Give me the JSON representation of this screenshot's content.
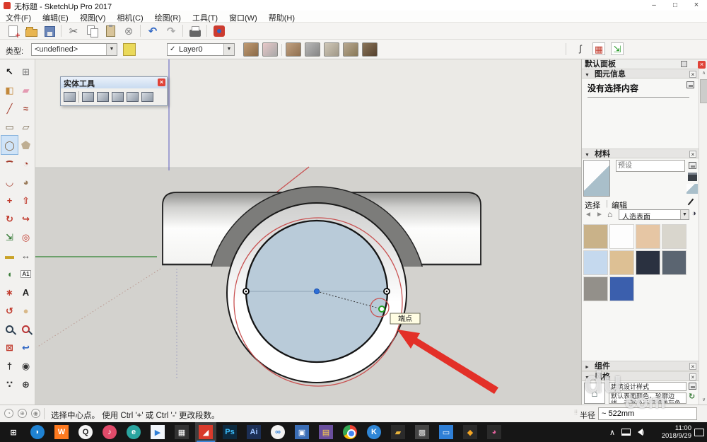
{
  "window": {
    "title": "无标题 - SketchUp Pro 2017",
    "controls": {
      "minimize": "–",
      "maximize": "□",
      "close": "×"
    }
  },
  "menu": {
    "items": [
      "文件(F)",
      "编辑(E)",
      "视图(V)",
      "相机(C)",
      "绘图(R)",
      "工具(T)",
      "窗口(W)",
      "帮助(H)"
    ]
  },
  "toolbar_main": {
    "buttons": [
      "new",
      "open",
      "save",
      "cut",
      "copy",
      "paste",
      "erase",
      "undo",
      "redo",
      "print",
      "model-info"
    ],
    "glyphs": {
      "cut": "✂",
      "erase": "⊗",
      "undo": "↶",
      "redo": "↷"
    }
  },
  "toolbar_context": {
    "type_label": "类型:",
    "type_value": "<undefined>",
    "layer_check": "✓",
    "layer_value": "Layer0",
    "caret": "▼",
    "sandbox_tools": [
      {
        "name": "sandbox-from-contours",
        "c1": "#c09a72",
        "c2": "#8a6a48"
      },
      {
        "name": "sandbox-from-scratch",
        "c1": "#e8c8c8",
        "c2": "#a8a8a8"
      },
      {
        "name": "smoove-tool",
        "c1": "#c0a080",
        "c2": "#907050"
      },
      {
        "name": "stamp-tool",
        "c1": "#b8b8b8",
        "c2": "#858585"
      },
      {
        "name": "drape-tool",
        "c1": "#d0c8b8",
        "c2": "#a09888"
      },
      {
        "name": "add-detail-tool",
        "c1": "#b8a890",
        "c2": "#887858"
      },
      {
        "name": "flip-edge-tool",
        "c1": "#8a7458",
        "c2": "#55412e"
      }
    ],
    "right_tools": [
      {
        "name": "hook-tool",
        "glyph": "ʃ",
        "color": "#333",
        "boxed": false
      },
      {
        "name": "red-grid-tool",
        "glyph": "▦",
        "color": "#c0392b",
        "boxed": true
      },
      {
        "name": "import-model-tool",
        "glyph": "⇲",
        "color": "#2a9a2a",
        "boxed": true
      }
    ]
  },
  "solid_tools": {
    "title": "实体工具",
    "tools": [
      "outer-shell",
      "intersect",
      "union",
      "subtract",
      "trim",
      "split"
    ]
  },
  "left_toolbar": {
    "tools": [
      {
        "name": "select-tool",
        "glyph": "↖",
        "color": "#111"
      },
      {
        "name": "make-component-tool",
        "glyph": "⊞",
        "color": "#8a8a8a"
      },
      {
        "name": "paint-bucket-tool",
        "glyph": "◧",
        "color": "#c2883a"
      },
      {
        "name": "eraser-tool",
        "glyph": "▰",
        "color": "#e49ab2"
      },
      {
        "name": "line-tool",
        "glyph": "╱",
        "color": "#a33a2a"
      },
      {
        "name": "freehand-tool",
        "glyph": "≈",
        "color": "#a33a2a"
      },
      {
        "name": "rectangle-tool",
        "glyph": "▭",
        "color": "#7a6a52"
      },
      {
        "name": "rotated-rectangle-tool",
        "glyph": "▱",
        "color": "#7a6a52"
      },
      {
        "name": "circle-tool",
        "glyph": "◯",
        "color": "#7a5c3a",
        "selected": true
      },
      {
        "name": "polygon-tool",
        "cls": "i-poly"
      },
      {
        "name": "arc-2pt-tool",
        "cls": "i-arc",
        "color": "#a33a2a"
      },
      {
        "name": "pie-tool",
        "glyph": "◔",
        "color": "#a33a2a"
      },
      {
        "name": "arc-3pt-tool",
        "glyph": "◡",
        "color": "#a33a2a"
      },
      {
        "name": "pie-filled-tool",
        "glyph": "◕",
        "color": "#9a7b5a"
      },
      {
        "name": "move-tool",
        "glyph": "+",
        "color": "#c0392b"
      },
      {
        "name": "push-pull-tool",
        "glyph": "⇧",
        "color": "#c0392b"
      },
      {
        "name": "rotate-tool",
        "glyph": "↻",
        "color": "#c0392b"
      },
      {
        "name": "follow-me-tool",
        "glyph": "↪",
        "color": "#c0392b"
      },
      {
        "name": "scale-tool",
        "glyph": "⇲",
        "color": "#3a7d3a"
      },
      {
        "name": "offset-tool",
        "glyph": "◎",
        "color": "#c0392b"
      },
      {
        "name": "tape-measure-tool",
        "glyph": "▬",
        "color": "#c9a227"
      },
      {
        "name": "dimension-tool",
        "glyph": "↔",
        "color": "#444"
      },
      {
        "name": "protractor-tool",
        "glyph": "◖",
        "color": "#3a7d3a"
      },
      {
        "name": "text-tool",
        "cls": "i-txt",
        "glyph": "A1"
      },
      {
        "name": "axes-tool",
        "glyph": "∗",
        "color": "#c0392b"
      },
      {
        "name": "3d-text-tool",
        "glyph": "A",
        "color": "#222"
      },
      {
        "name": "orbit-tool",
        "glyph": "↺",
        "color": "#c0392b"
      },
      {
        "name": "pan-tool",
        "glyph": "●",
        "color": "#d9b98a"
      },
      {
        "name": "zoom-tool",
        "cls": "i-zoom"
      },
      {
        "name": "zoom-window-tool",
        "cls": "i-zoom red"
      },
      {
        "name": "zoom-extents-tool",
        "glyph": "⊠",
        "color": "#c0392b"
      },
      {
        "name": "zoom-previous-tool",
        "glyph": "↩",
        "color": "#2f66c4"
      },
      {
        "name": "position-camera-tool",
        "glyph": "†",
        "color": "#333"
      },
      {
        "name": "look-around-tool",
        "glyph": "◉",
        "color": "#333"
      },
      {
        "name": "walk-tool",
        "glyph": "∵",
        "color": "#333"
      },
      {
        "name": "target-tool",
        "glyph": "⊕",
        "color": "#333"
      }
    ]
  },
  "viewport": {
    "tooltip": "端点",
    "sky_color": "#ebeae6",
    "ground_color": "#d3d2ce",
    "face_color": "#b9cbd9",
    "highlight_red": "#c95252"
  },
  "panel": {
    "title": "默认面板",
    "entity_info": {
      "title": "图元信息",
      "empty_text": "没有选择内容"
    },
    "materials": {
      "title": "材料",
      "name_placeholder": "预设",
      "tabs": [
        "选择",
        "编辑"
      ],
      "collection": "人造表面",
      "swatches": [
        "#c9b289",
        "#fdfdfd",
        "#e6c6a4",
        "#d9d6cd",
        "#c5d9ee",
        "#ddc094",
        "#2a3140",
        "#5b6571",
        "#93908a",
        "#3b5fad"
      ]
    },
    "components": {
      "title": "组件"
    },
    "styles": {
      "title": "风格",
      "style_name": "建筑设计样式",
      "description": "默认表面颜色，轮廓边线，天蓝色天空和浅灰色背景颜色。"
    }
  },
  "status_bar": {
    "icons": [
      {
        "name": "geolocation-icon",
        "glyph": "◔"
      },
      {
        "name": "claim-credit-icon",
        "glyph": "⊕"
      },
      {
        "name": "sign-in-icon",
        "glyph": "◉"
      }
    ],
    "message": "选择中心点。 使用 Ctrl '+' 或 Ctrl '-' 更改段数。",
    "radius_label": "半径",
    "radius_value": "~ 522mm"
  },
  "taskbar": {
    "apps": [
      {
        "name": "start-button",
        "bg": "transparent",
        "fg": "#ffffff",
        "glyph": "⊞"
      },
      {
        "name": "browser-app",
        "bg": "#1f82d2",
        "fg": "#ffffff",
        "glyph": "◗",
        "round": true
      },
      {
        "name": "wangwang-app",
        "bg": "#ff7a1f",
        "fg": "#ffffff",
        "glyph": "W"
      },
      {
        "name": "qq-app",
        "bg": "#f5f5f5",
        "fg": "#222222",
        "glyph": "Q",
        "round": true
      },
      {
        "name": "music-app",
        "bg": "#e14b6a",
        "fg": "#ffffff",
        "glyph": "♪",
        "round": true
      },
      {
        "name": "cloud-download-app",
        "bg": "#2aa5a0",
        "fg": "#ffffff",
        "glyph": "e",
        "round": true
      },
      {
        "name": "bird-messenger-app",
        "bg": "#f2f6fb",
        "fg": "#2f7fd6",
        "glyph": "▶"
      },
      {
        "name": "calculator-app",
        "bg": "#333333",
        "fg": "#ffffff",
        "glyph": "▦"
      },
      {
        "name": "sketchup-app",
        "bg": "#d93a2b",
        "fg": "#ffffff",
        "glyph": "◢",
        "active": true
      },
      {
        "name": "photoshop-app",
        "bg": "#0d2a3f",
        "fg": "#3cc1ff",
        "glyph": "Ps"
      },
      {
        "name": "illustrator-app",
        "bg": "#1c2f55",
        "fg": "#9cc3ff",
        "glyph": "Ai"
      },
      {
        "name": "cloud-drive-app",
        "bg": "#f2f2f2",
        "fg": "#2f7fd6",
        "glyph": "∞",
        "round": true
      },
      {
        "name": "office-app",
        "bg": "#3a6db5",
        "fg": "#ffffff",
        "glyph": "▣"
      },
      {
        "name": "winrar-app",
        "bg": "#6a4f9e",
        "fg": "#ffd24a",
        "glyph": "▤"
      },
      {
        "name": "chrome-app",
        "bg": "",
        "fg": "",
        "glyph": "",
        "chrome": true
      },
      {
        "name": "k-app",
        "bg": "#2f86d6",
        "fg": "#ffffff",
        "glyph": "K",
        "round": true
      },
      {
        "name": "file-explorer",
        "bg": "#2b2b2b",
        "fg": "#e8b33a",
        "glyph": "▰"
      },
      {
        "name": "screenshot-app",
        "bg": "#454545",
        "fg": "#dddddd",
        "glyph": "▩"
      },
      {
        "name": "tv-app",
        "bg": "#2f7fd6",
        "fg": "#ffffff",
        "glyph": "▭"
      },
      {
        "name": "security-app",
        "bg": "#2b2b2b",
        "fg": "#f5a623",
        "glyph": "◆"
      },
      {
        "name": "palette-app",
        "bg": "#2b2b2b",
        "fg": "#e0609a",
        "glyph": "◕"
      }
    ],
    "tray": {
      "time": "11:00",
      "date": "2018/9/29"
    }
  },
  "watermark": {
    "fragments": [
      "du",
      "com"
    ]
  }
}
